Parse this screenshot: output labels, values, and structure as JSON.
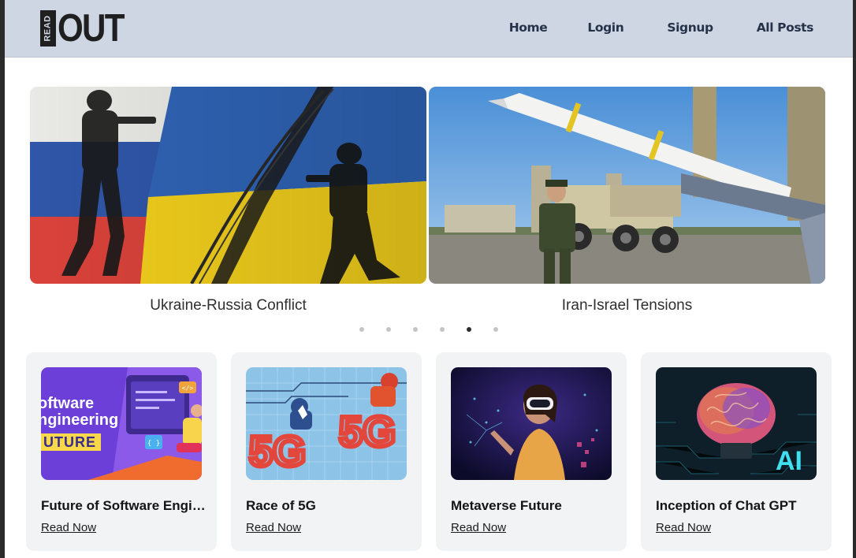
{
  "brand": {
    "logo_small": "READ",
    "logo_large": "OUT"
  },
  "nav": {
    "items": [
      "Home",
      "Login",
      "Signup",
      "All Posts"
    ]
  },
  "carousel": {
    "slides": [
      {
        "caption": "Ukraine-Russia Conflict"
      },
      {
        "caption": "Iran-Israel Tensions"
      }
    ],
    "dots_count": 6,
    "active_dot": 5
  },
  "cards": [
    {
      "title": "Future of Software Engineering",
      "link": "Read Now",
      "thumb_text": [
        "oftware",
        "ngineering",
        "UTURE"
      ]
    },
    {
      "title": "Race of 5G",
      "link": "Read Now",
      "thumb_text": "5G"
    },
    {
      "title": "Metaverse Future",
      "link": "Read Now"
    },
    {
      "title": "Inception of Chat GPT",
      "link": "Read Now",
      "thumb_text": "AI"
    }
  ],
  "colors": {
    "navbar": "#cdd6e2",
    "nav_text": "#26324a",
    "card_bg": "#f2f3f5",
    "active_dot": "#2d2d2d"
  }
}
